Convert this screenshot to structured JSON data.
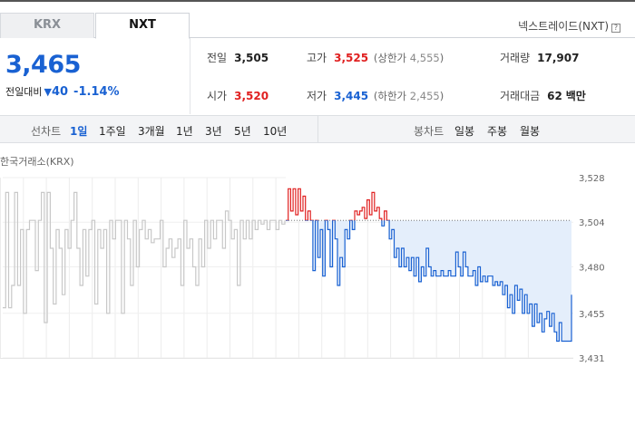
{
  "market_tabs": [
    {
      "label": "KRX",
      "selected": false
    },
    {
      "label": "NXT",
      "selected": true
    }
  ],
  "exchange": {
    "label": "넥스트레이드(NXT)",
    "help_icon": "question-box-icon"
  },
  "quote": {
    "price": "3,465",
    "prev_label": "전일대비",
    "direction_icon": "down-triangle-icon",
    "change": "40",
    "change_pct": "-1.14%"
  },
  "stats": {
    "prev_close": {
      "label": "전일",
      "value": "3,505"
    },
    "high": {
      "label": "고가",
      "value": "3,525",
      "limit_label": "상한가",
      "limit_value": "4,555"
    },
    "volume": {
      "label": "거래량",
      "value": "17,907"
    },
    "open": {
      "label": "시가",
      "value": "3,520"
    },
    "low": {
      "label": "저가",
      "value": "3,445",
      "limit_label": "하한가",
      "limit_value": "2,455"
    },
    "amount": {
      "label": "거래대금",
      "value": "62",
      "unit": "백만"
    }
  },
  "period_bar": {
    "line_label": "선차트",
    "periods": [
      "1일",
      "1주일",
      "3개월",
      "1년",
      "3년",
      "5년",
      "10년"
    ],
    "selected": "1일",
    "candle_label": "봉차트",
    "candles": [
      "일봉",
      "주봉",
      "월봉"
    ]
  },
  "chart_source": "한국거래소(KRX)",
  "colors": {
    "up": "#e02020",
    "down": "#1961d2",
    "krx_line": "#c8c8c8",
    "fill": "#e4eefb"
  },
  "chart_data": {
    "type": "line",
    "title": "",
    "reference_line": 3505,
    "ylim": [
      3431,
      3528
    ],
    "y_ticks": [
      "3,528",
      "3,504",
      "3,480",
      "3,455",
      "3,431"
    ],
    "y_tick_values": [
      3528,
      3504,
      3480,
      3455,
      3431
    ],
    "series": [
      {
        "values": [
          3458,
          3520,
          3458,
          3470,
          3520,
          3470,
          3500,
          3455,
          3500,
          3505,
          3505,
          3478,
          3505,
          3520,
          3450,
          3520,
          3490,
          3460,
          3500,
          3490,
          3465,
          3500,
          3490,
          3505,
          3520,
          3490,
          3470,
          3500,
          3475,
          3500,
          3505,
          3460,
          3500,
          3490,
          3500,
          3455,
          3505,
          3495,
          3505,
          3505,
          3455,
          3505,
          3495,
          3470,
          3505,
          3480,
          3500,
          3505,
          3495,
          3500,
          3493,
          3495,
          3495,
          3505,
          3480,
          3490,
          3495,
          3485,
          3490,
          3495,
          3470,
          3505,
          3490,
          3495,
          3480,
          3470,
          3495,
          3480,
          3505,
          3490,
          3505,
          3495,
          3505,
          3505,
          3490,
          3510,
          3505,
          3495,
          3500,
          3470,
          3505,
          3495,
          3505,
          3495,
          3505,
          3500,
          3505,
          3503,
          3505,
          3500,
          3505,
          3505,
          3500,
          3505,
          3503,
          3505
        ]
      },
      {
        "values": [
          3505,
          3522,
          3510,
          3522,
          3508,
          3522,
          3510,
          3518,
          3505,
          3510,
          3505,
          3478,
          3505,
          3485,
          3500,
          3475,
          3505,
          3500,
          3480,
          3505,
          3495,
          3470,
          3485,
          3480,
          3500,
          3495,
          3505,
          3500,
          3510,
          3508,
          3510,
          3512,
          3506,
          3516,
          3508,
          3520,
          3510,
          3512,
          3506,
          3502,
          3510,
          3505,
          3495,
          3500,
          3485,
          3490,
          3480,
          3490,
          3480,
          3485,
          3478,
          3485,
          3475,
          3485,
          3472,
          3480,
          3475,
          3490,
          3480,
          3475,
          3478,
          3475,
          3475,
          3478,
          3475,
          3475,
          3478,
          3475,
          3475,
          3488,
          3480,
          3475,
          3488,
          3480,
          3475,
          3475,
          3478,
          3470,
          3480,
          3472,
          3475,
          3472,
          3475,
          3475,
          3470,
          3472,
          3470,
          3472,
          3465,
          3470,
          3458,
          3465,
          3455,
          3470,
          3462,
          3468,
          3455,
          3465,
          3455,
          3460,
          3448,
          3460,
          3450,
          3455,
          3445,
          3452,
          3456,
          3448,
          3455,
          3445,
          3440,
          3450,
          3440,
          3440,
          3440,
          3440,
          3465
        ]
      }
    ]
  }
}
